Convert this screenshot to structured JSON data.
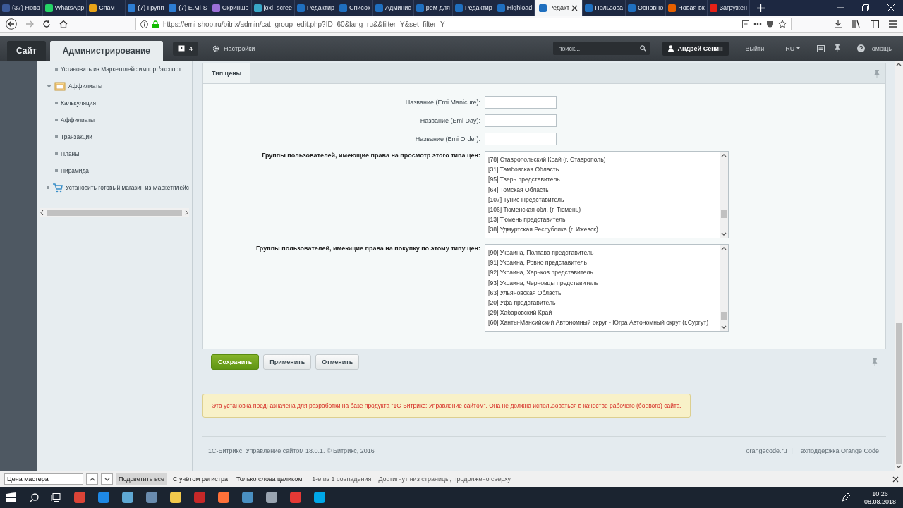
{
  "browser": {
    "tabs": [
      {
        "label": "(37) Ново",
        "color": "#3b5998",
        "selected": false
      },
      {
        "label": "WhatsApp",
        "color": "#25d366",
        "selected": false
      },
      {
        "label": "Спам —",
        "color": "#e8a317",
        "selected": false
      },
      {
        "label": "(7) Групп",
        "color": "#2d7dd2",
        "selected": false
      },
      {
        "label": "(7) E.Mi-S",
        "color": "#2d7dd2",
        "selected": false
      },
      {
        "label": "Скриншо",
        "color": "#9b6fd6",
        "selected": false
      },
      {
        "label": "joxi_scree",
        "color": "#39a7c7",
        "selected": false
      },
      {
        "label": "Редактир",
        "color": "#1f6fbf",
        "selected": false
      },
      {
        "label": "Список",
        "color": "#1f6fbf",
        "selected": false
      },
      {
        "label": "Админис",
        "color": "#1f6fbf",
        "selected": false
      },
      {
        "label": "рем для",
        "color": "#1f6fbf",
        "selected": false
      },
      {
        "label": "Редактир",
        "color": "#1f6fbf",
        "selected": false
      },
      {
        "label": "Highload",
        "color": "#1f6fbf",
        "selected": false
      },
      {
        "label": "Редакт",
        "color": "#1f6fbf",
        "selected": true
      },
      {
        "label": "Пользова",
        "color": "#1f6fbf",
        "selected": false
      },
      {
        "label": "Основно",
        "color": "#1f6fbf",
        "selected": false
      },
      {
        "label": "Новая вк",
        "color": "#e66000",
        "selected": false
      },
      {
        "label": "Загружен",
        "color": "#e62117",
        "selected": false
      }
    ],
    "url": "https://emi-shop.ru/bitrix/admin/cat_group_edit.php?ID=60&lang=ru&&filter=Y&set_filter=Y"
  },
  "admin_bar": {
    "tabs": [
      {
        "label": "Сайт",
        "selected": false
      },
      {
        "label": "Администрирование",
        "selected": true
      }
    ],
    "notifications": "4",
    "settings": "Настройки",
    "search": {
      "placeholder": "поиск..."
    },
    "user": "Андрей Сенин",
    "logout": "Выйти",
    "language": "RU",
    "help": "Помощь"
  },
  "sidebar": {
    "items": [
      {
        "label": "Установить из Маркетплейс импорт/экспорт",
        "kind": "link"
      },
      {
        "label": "Аффилиаты",
        "kind": "section",
        "expanded": true,
        "children": [
          {
            "label": "Калькуляция",
            "kind": "link"
          },
          {
            "label": "Аффилиаты",
            "kind": "link"
          },
          {
            "label": "Транзакции",
            "kind": "link"
          },
          {
            "label": "Планы",
            "kind": "link"
          },
          {
            "label": "Пирамида",
            "kind": "link"
          }
        ]
      },
      {
        "label": "Установить готовый магазин из Маркетплейс",
        "kind": "module"
      }
    ]
  },
  "form": {
    "tab": "Тип цены",
    "fields": [
      {
        "label": "Название (Emi Manicure):"
      },
      {
        "label": "Название (Emi Day):"
      },
      {
        "label": "Название (Emi Order):"
      }
    ],
    "lists": [
      {
        "label": "Группы пользователей, имеющие права на просмотр этого типа цен:",
        "options": [
          "[78] Ставропольский Край (г. Ставрополь)",
          "[31] Тамбовская Область",
          "[95] Тверь представитель",
          "[64] Томская Область",
          "[107] Тунис Представитель",
          "[106] Тюменская обл. (г. Тюмень)",
          "[13] Тюмень представитель",
          "[38] Удмуртская Республика (г. Ижевск)"
        ]
      },
      {
        "label": "Группы пользователей, имеющие права на покупку по этому типу цен:",
        "options": [
          "[90] Украина, Полтава представитель",
          "[91] Украина, Ровно представитель",
          "[92] Украина, Харьков представитель",
          "[93] Украина, Черновцы представитель",
          "[63] Ульяновская Область",
          "[20] Уфа представитель",
          "[29] Хабаровский Край",
          "[60] Ханты-Мансийский Автономный округ - Югра Автономный округ (г.Сургут)"
        ]
      }
    ],
    "buttons": [
      {
        "label": "Сохранить",
        "kind": "primary"
      },
      {
        "label": "Применить",
        "kind": "default"
      },
      {
        "label": "Отменить",
        "kind": "default"
      }
    ]
  },
  "warning": "Эта установка предназначена для разработки на базе продукта \"1С-Битрикс: Управление сайтом\". Она не должна использоваться в качестве рабочего (боевого) сайта.",
  "footer": {
    "copyright": "1С-Битрикс: Управление сайтом 18.0.1. © Битрикс, 2016",
    "links": [
      "orangecode.ru",
      "Техподдержка Orange Code"
    ],
    "separator": "|"
  },
  "find_bar": {
    "value": "Цена мастера",
    "buttons": [
      {
        "label": "Подсветить все",
        "selected": true
      },
      {
        "label": "С учётом регистра",
        "selected": false
      },
      {
        "label": "Только слова целиком",
        "selected": false
      }
    ],
    "matches": "1-е из 1 совпадения",
    "status": "Достигнут низ страницы, продолжено сверху"
  },
  "taskbar": {
    "apps": [
      {
        "color": "#db4437"
      },
      {
        "color": "#1e88e5"
      },
      {
        "color": "#5fa8d3"
      },
      {
        "color": "#6a8caf"
      },
      {
        "color": "#f2c94c"
      },
      {
        "color": "#c62828"
      },
      {
        "color": "#ff7139"
      },
      {
        "color": "#4a90c2"
      },
      {
        "color": "#9aa5b1"
      },
      {
        "color": "#e53935"
      },
      {
        "color": "#00a8e8"
      }
    ],
    "time": "10:26",
    "date": "08.08.2018"
  }
}
